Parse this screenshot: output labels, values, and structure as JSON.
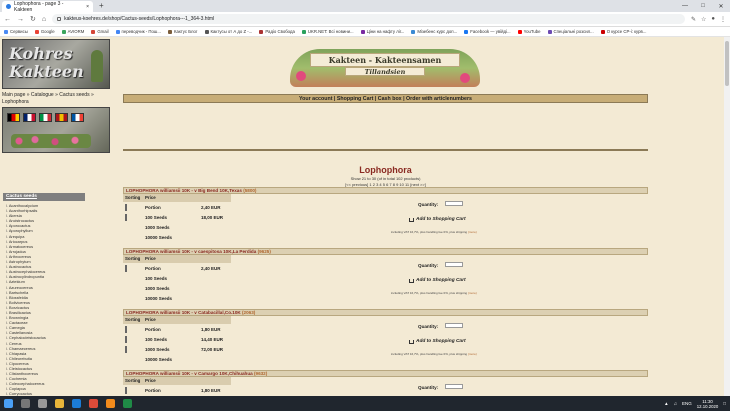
{
  "browser": {
    "tab_title": "Lophophora - page 3 - Kakteen",
    "tab_close": "×",
    "new_tab": "+",
    "url": "kakteus-koehres.de/shop/Cactus-seeds/Lophophora---1_364-3.html",
    "bookmarks": [
      "Сервисы",
      "Google",
      "AVIORM",
      "Gmail",
      "переводчик - Пош...",
      "Кактус Блог",
      "Кактусы от А до Z -...",
      "Радіо Свобода",
      "UKR.NET: Всі новини...",
      "Ціни на нафту ліг...",
      "Мізебенс курс доп...",
      "Facebook — увійді...",
      "YouTube",
      "Спеціальні розсил...",
      "О курсе СР-і: курв..."
    ],
    "bookmark_colors": [
      "#4a8af4",
      "#ea4335",
      "#3ba55d",
      "#d44638",
      "#4285f4",
      "#7a5c3a",
      "#555555",
      "#a33",
      "#2aa15d",
      "#7a2aa1",
      "#3b8ad3",
      "#1877f2",
      "#ff0000",
      "#6c4ab2",
      "#cc0000"
    ]
  },
  "site": {
    "logo_line1": "Kohres",
    "logo_line2": "Kakteen",
    "banner_title": "Kakteen - Kakteensamen",
    "banner_sub": "Tillandsien",
    "breadcrumb": [
      "Main page",
      "Catalogue",
      "Cactus seeds",
      "Lophophora"
    ],
    "breadcrumb_sep": " » ",
    "nav": "Your account | Shopping Cart | Cash box | Order with articlenumbers",
    "flags": [
      {
        "name": "de-flag",
        "colors": [
          "#000000",
          "#dd0000",
          "#ffce00"
        ]
      },
      {
        "name": "gb-flag",
        "colors": [
          "#012169",
          "#ffffff",
          "#c8102e"
        ]
      },
      {
        "name": "it-flag",
        "colors": [
          "#009246",
          "#ffffff",
          "#ce2b37"
        ]
      },
      {
        "name": "es-flag",
        "colors": [
          "#aa151b",
          "#f1bf00",
          "#aa151b"
        ]
      },
      {
        "name": "fr-flag",
        "colors": [
          "#0055a4",
          "#ffffff",
          "#ef4135"
        ]
      }
    ]
  },
  "sidebar": {
    "title": "Cactus seeds",
    "items": [
      "Acanthocalycium",
      "Acanthorhipsalis",
      "Akersia",
      "Ancistrocactus",
      "Aporocactus",
      "Aporophyllum",
      "Arequipa",
      "Ariocarpus",
      "Armatocereus",
      "Arrojadoa",
      "Arthrocereus",
      "Astrophytum",
      "Austrocactus",
      "Austrocephalocereus",
      "Austrocylindropuntia",
      "Aztekium",
      "Azureocereus",
      "Bartschella",
      "Blossfeldia",
      "Bolivicereus",
      "Borzicactus",
      "Brasilicactus",
      "Browningia",
      "Cactaceae",
      "Carnegia",
      "Castellanosia",
      "Cephalocleistocactus",
      "Cereus",
      "Chamaecereus",
      "Chiapasia",
      "Chileorebutia",
      "Cipocereus",
      "Cleistocactus",
      "Clistanthocereus",
      "Cochemia",
      "Coleocephalocereus",
      "Copiapoa",
      "Corryocactus",
      "Coryphantha",
      "Cumulopuntia"
    ]
  },
  "main": {
    "title": "Lophophora",
    "showing": "Show 21 to 30 (of in total 102 products)",
    "pager": "[<< previous]   1  2  3  4  5  6  7  8  9  10  11   [next >>]",
    "sorting_label": "Sorting",
    "price_label": "Price",
    "quantity_label": "Quantity:",
    "add_label": "Add to Shopping Cart",
    "vat_note": "including VAT 16,7%, plus handling fee 0%, plus shipping",
    "more_label": "(more)"
  },
  "products": [
    {
      "name": "LOPHOPHORA williamsii 10K - v Big Bend 10K,Texas",
      "code": "(5800)",
      "options": [
        {
          "label": "Portion",
          "price": "2,40 EUR",
          "checkbox": true
        },
        {
          "label": "100 Seeds",
          "price": "18,00 EUR",
          "checkbox": true
        },
        {
          "label": "1000 Seeds",
          "price": "",
          "checkbox": false
        },
        {
          "label": "10000 Seeds",
          "price": "",
          "checkbox": false
        }
      ]
    },
    {
      "name": "LOPHOPHORA williamsii 10K - v caespitosa 10K,La Perdida",
      "code": "(9625)",
      "options": [
        {
          "label": "Portion",
          "price": "2,40 EUR",
          "checkbox": true
        },
        {
          "label": "100 Seeds",
          "price": "",
          "checkbox": false
        },
        {
          "label": "1000 Seeds",
          "price": "",
          "checkbox": false
        },
        {
          "label": "10000 Seeds",
          "price": "",
          "checkbox": false
        }
      ]
    },
    {
      "name": "LOPHOPHORA williamsii 10K - v Catabacillal,Co.10K",
      "code": "(2063)",
      "options": [
        {
          "label": "Portion",
          "price": "1,80 EUR",
          "checkbox": true
        },
        {
          "label": "100 Seeds",
          "price": "14,40 EUR",
          "checkbox": true
        },
        {
          "label": "1000 Seeds",
          "price": "72,00 EUR",
          "checkbox": true
        },
        {
          "label": "10000 Seeds",
          "price": "",
          "checkbox": false
        }
      ]
    },
    {
      "name": "LOPHOPHORA williamsii 10K - v Camargo 10K,Chihuahua",
      "code": "(9632)",
      "options": [
        {
          "label": "Portion",
          "price": "1,80 EUR",
          "checkbox": true
        },
        {
          "label": "100 Seeds",
          "price": "14,00 EUR",
          "checkbox": true
        },
        {
          "label": "1000 Seeds",
          "price": "58,00 EUR",
          "checkbox": true
        },
        {
          "label": "10000 Seeds",
          "price": "",
          "checkbox": false
        }
      ]
    }
  ],
  "taskbar": {
    "lang": "ENG",
    "time": "11:30",
    "date": "12.10.2020"
  }
}
